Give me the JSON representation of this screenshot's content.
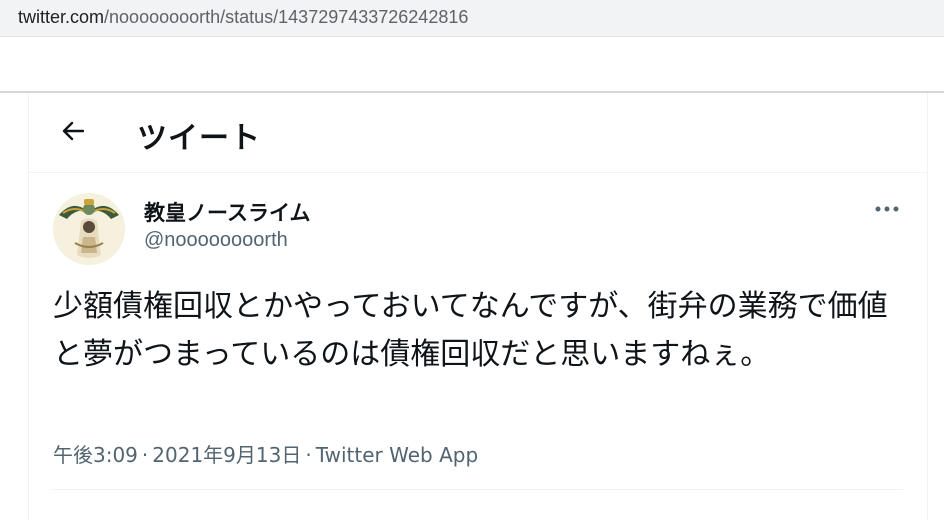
{
  "browser": {
    "url_host": "twitter.com",
    "url_path": "/noooooooorth/status/1437297433726242816"
  },
  "header": {
    "back_icon": "back-arrow-icon",
    "title": "ツイート"
  },
  "tweet": {
    "display_name": "教皇ノースライム",
    "handle": "@noooooooorth",
    "more_icon": "more-dots-icon",
    "text": "少額債権回収とかやっておいてなんですが、街弁の業務で価値と夢がつまっているのは債権回収だと思いますねぇ。",
    "time": "午後3:09",
    "separator": "·",
    "date": "2021年9月13日",
    "source": "Twitter Web App"
  },
  "colors": {
    "text_primary": "#0f1419",
    "text_secondary": "#536471",
    "border": "#eff3f4"
  }
}
